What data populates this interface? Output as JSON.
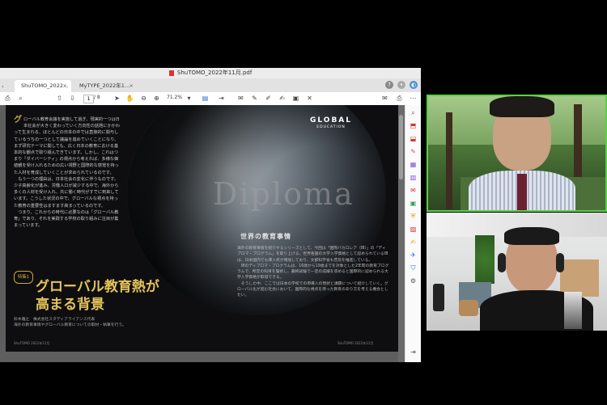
{
  "window": {
    "title": "ShuTOMO_2022年11月.pdf"
  },
  "tabs": [
    {
      "label": "ShuTOMO_2022…",
      "active": true
    },
    {
      "label": "MyTYPE_2022年1…",
      "active": false
    }
  ],
  "toolbar": {
    "page_current": "1",
    "page_total": "/ 8",
    "zoom": "71.2%"
  },
  "page": {
    "col_left_first_char": "グ",
    "col_left_text": "ローバル教育会議を実施して過ぎ、現実的一つは日本社会が大きく変わっていく方向性の話題にかかわって生まれる、ほとんどの日本の中では直接的に関与しているうちの一つとして議論を進めていくことになり、まず研究テーマに関しても、広く日本の教育における基本的な観点で取り組んできています。しかし、これはつまり「ダイバーシティ」の視点から考えれば、多様な価値観を受け入れるための広い視野と国際的な感覚を持った人材を育成していくことが求められているのです。\n　もう一つの理由は、日本社会の変化に伴うものです。少子高齢化が進み、労働人口が減少する中で、海外から多くの人材を受け入れ、共に働く時代がすでに到来しています。こうした状況の中で、グローバルな視点を持った教育の重要性はますます高まっているのです。\n　つまり、これからの時代に必要なのは「グローバル教育」であり、それを実践する学校の取り組みに注目が集まっています。",
    "global_logo": "GLOBAL",
    "global_sub": "EDUCATION",
    "diploma_word": "Diploma",
    "section_heading": "世界の教育事情",
    "col_right_text": "海外の教育事情を紹介するシリーズとして、今回は「国際バカロレア（IB）」の「ディプロマ・プログラム」を取り上げる。世界各国の大学入学資格として認められているIBは、日本国内でも導入校が増加しており、文部科学省も普及を推進している。\n　IBのディプロマ・プログラムは、16歳から19歳までを対象とした2年間の教育プログラムで、所定の科目を履修し、最終試験で一定の成績を収めると国際的に認められる大学入学資格が取得できる。\n　そうした中、ここでは日本の学校でのIB導入の現状と課題について紹介していく。グローバル化が進む社会において、国際的な視点を持った教育のあり方を考える機会としたい。",
    "feature_badge": "特集1",
    "feature_title_line1": "グローバル教育熱が",
    "feature_title_line2": "高まる背景",
    "author": "鈴木雅之　株式会社スタディアライアンス代表\n海外の教育事情やグローバル教育についての取材・執筆を行う。",
    "footer_left": "ShuTOMO 2022年11月",
    "footer_right": "ShuTOMO 2022年11月"
  },
  "colors": {
    "accent_gold": "#c8a64a",
    "video_border": "#5ccf4a"
  }
}
